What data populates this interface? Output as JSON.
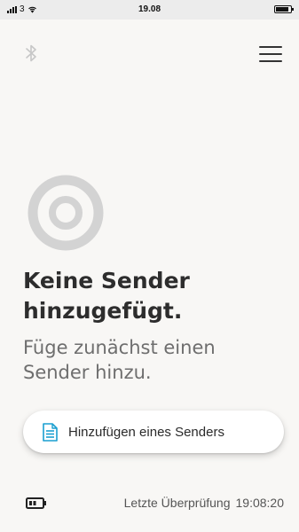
{
  "status_bar": {
    "carrier": "3",
    "time": "19.08"
  },
  "header": {
    "bluetooth_icon": "bluetooth-icon",
    "menu_icon": "hamburger-menu-icon"
  },
  "empty_state": {
    "title": "Keine Sender hinzugefügt.",
    "subtitle": "Füge zunächst einen Sender hinzu.",
    "graphic": "sender-device-icon"
  },
  "add_button": {
    "label": "Hinzufügen eines Senders",
    "icon": "document-icon",
    "icon_color": "#1a9fd0"
  },
  "footer": {
    "battery_icon": "battery-icon",
    "last_check_label": "Letzte Überprüfung",
    "last_check_time": "19:08:20"
  }
}
